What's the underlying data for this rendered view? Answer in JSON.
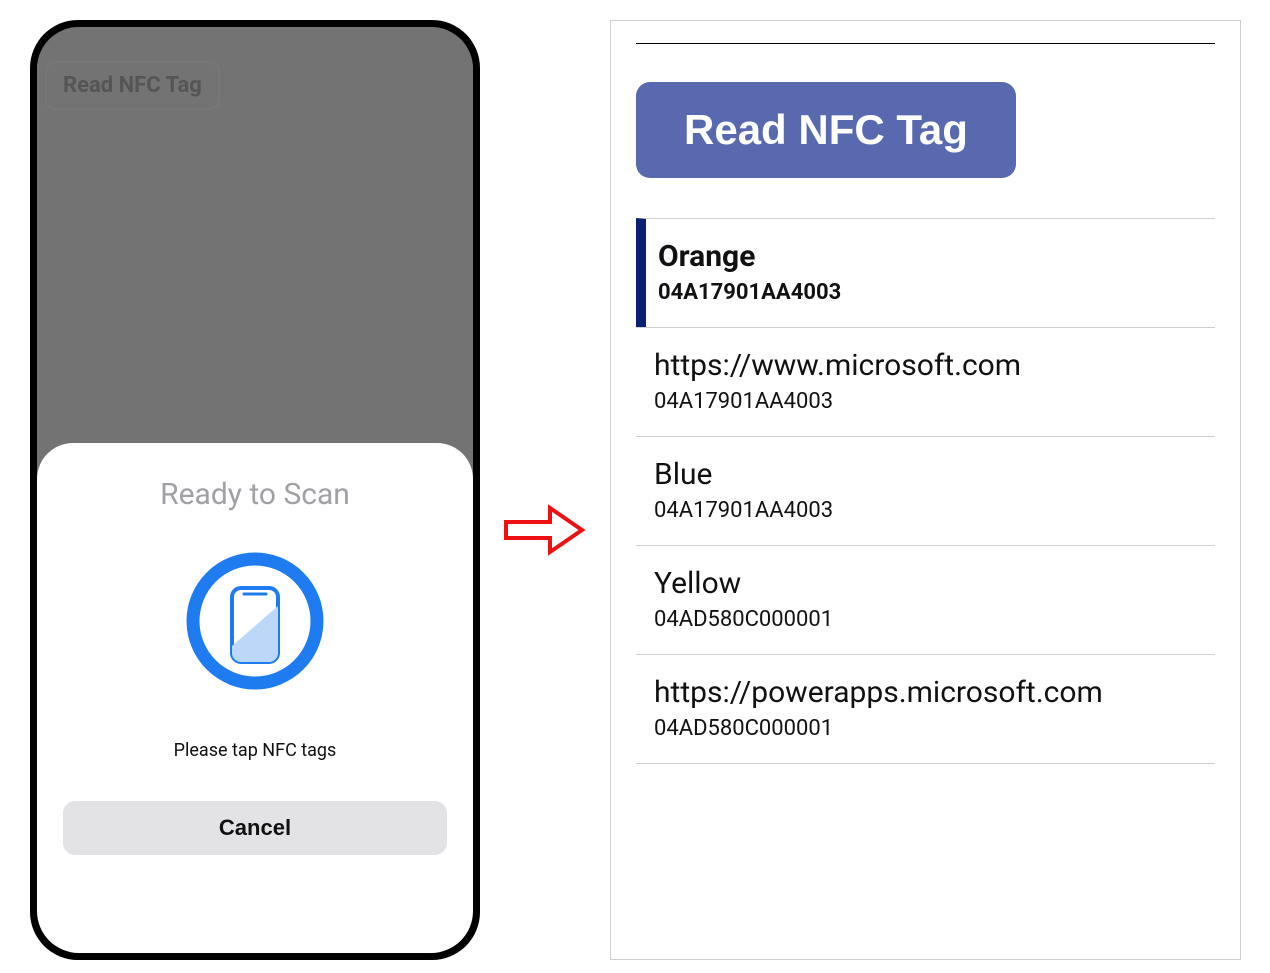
{
  "left": {
    "background_button": "Read NFC Tag",
    "sheet": {
      "title": "Ready to Scan",
      "subtitle": "Please tap NFC tags",
      "cancel": "Cancel"
    }
  },
  "right": {
    "button": "Read NFC Tag",
    "items": [
      {
        "title": "Orange",
        "sub": "04A17901AA4003",
        "selected": true
      },
      {
        "title": "https://www.microsoft.com",
        "sub": "04A17901AA4003",
        "selected": false
      },
      {
        "title": "Blue",
        "sub": "04A17901AA4003",
        "selected": false
      },
      {
        "title": "Yellow",
        "sub": "04AD580C000001",
        "selected": false
      },
      {
        "title": "https://powerapps.microsoft.com",
        "sub": "04AD580C000001",
        "selected": false
      }
    ]
  }
}
